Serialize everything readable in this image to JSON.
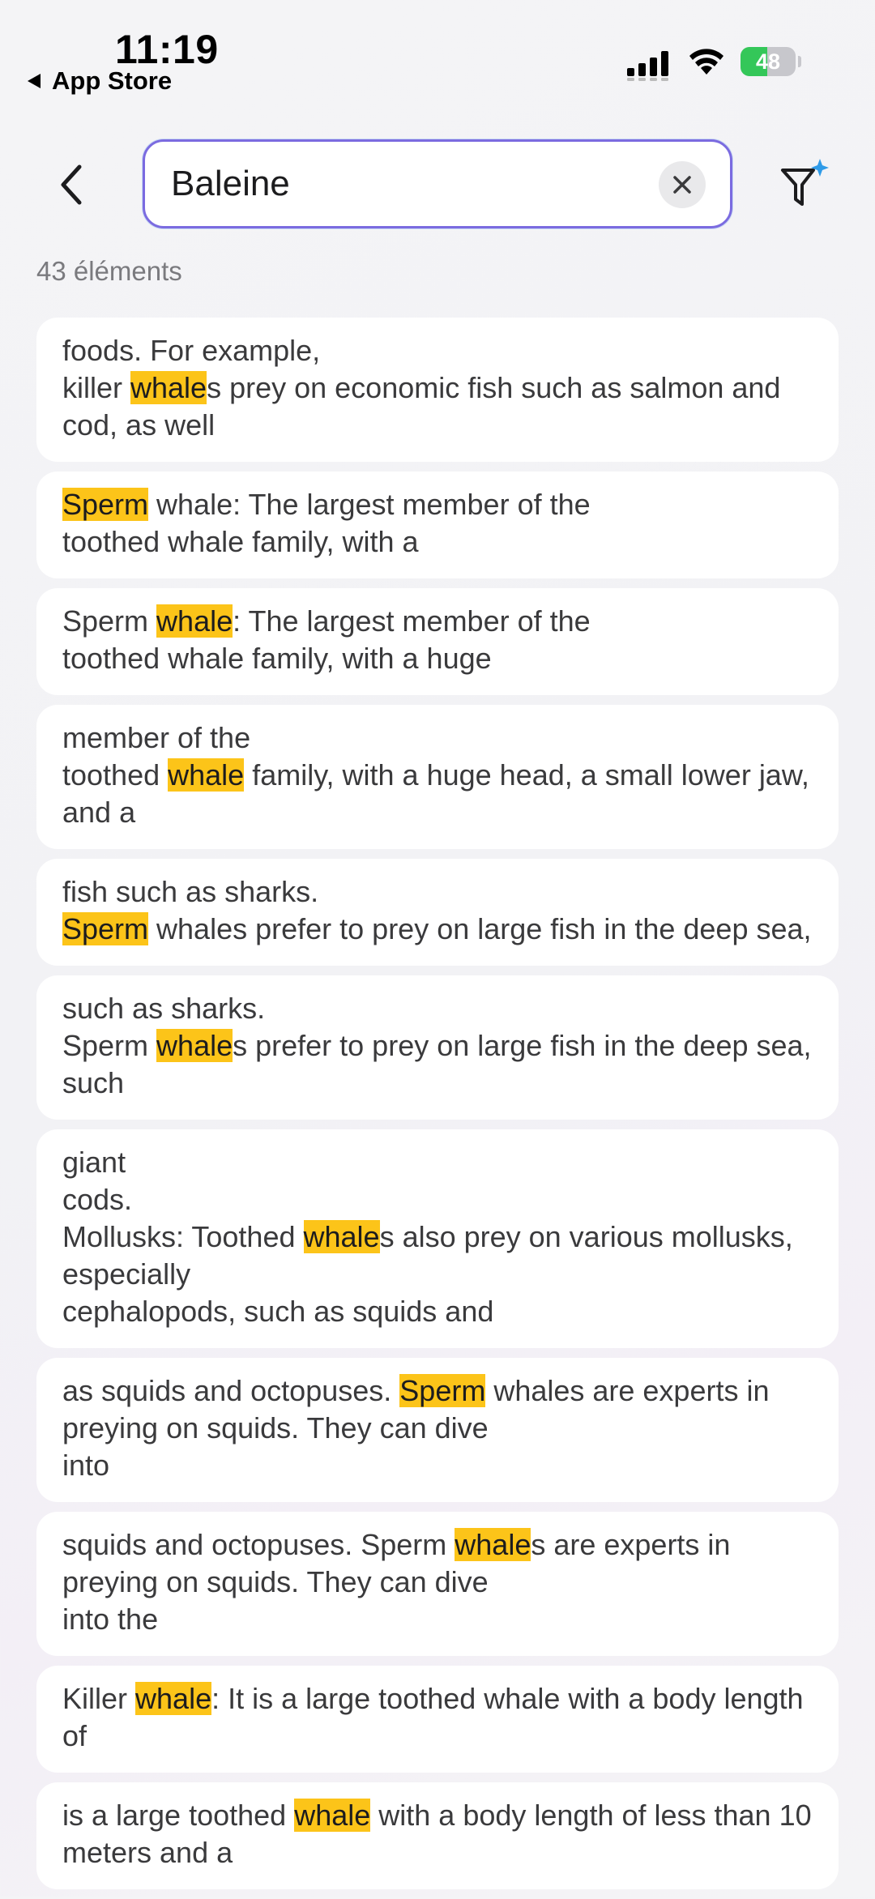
{
  "status_bar": {
    "time": "11:19",
    "back_app": "App Store",
    "battery_percent": 48,
    "battery_label": "48"
  },
  "search": {
    "query": "Baleine",
    "placeholder": ""
  },
  "results": {
    "count_label": "43 éléments",
    "highlight_color": "#fcc419",
    "items": [
      [
        {
          "t": "foods. For example,\nkiller "
        },
        {
          "h": "whale"
        },
        {
          "t": "s prey on economic fish such as salmon and cod, as well"
        }
      ],
      [
        {
          "h": "Sperm"
        },
        {
          "t": " whale: The largest member of the\ntoothed whale family, with a"
        }
      ],
      [
        {
          "t": "Sperm "
        },
        {
          "h": "whale"
        },
        {
          "t": ": The largest member of the\ntoothed whale family, with a huge"
        }
      ],
      [
        {
          "t": "member of the\ntoothed "
        },
        {
          "h": "whale"
        },
        {
          "t": " family, with a huge head, a small lower jaw, and a"
        }
      ],
      [
        {
          "t": "fish such as sharks.\n"
        },
        {
          "h": "Sperm"
        },
        {
          "t": " whales prefer to prey on large fish in the deep sea,"
        }
      ],
      [
        {
          "t": "such as sharks.\nSperm "
        },
        {
          "h": "whale"
        },
        {
          "t": "s prefer to prey on large fish in the deep sea, such"
        }
      ],
      [
        {
          "t": "giant\ncods.\nMollusks: Toothed "
        },
        {
          "h": "whale"
        },
        {
          "t": "s also prey on various mollusks, especially\ncephalopods, such as squids and"
        }
      ],
      [
        {
          "t": "as squids and octopuses. "
        },
        {
          "h": "Sperm"
        },
        {
          "t": " whales are experts in preying on squids. They can dive\ninto"
        }
      ],
      [
        {
          "t": "squids and octopuses. Sperm "
        },
        {
          "h": "whale"
        },
        {
          "t": "s are experts in preying on squids. They can dive\ninto the"
        }
      ],
      [
        {
          "t": "Killer "
        },
        {
          "h": "whale"
        },
        {
          "t": ": It is a large toothed whale with a body length of"
        }
      ],
      [
        {
          "t": "is a large toothed "
        },
        {
          "h": "whale"
        },
        {
          "t": " with a body length of less than 10 meters and a"
        }
      ]
    ]
  },
  "icons": {
    "back": "chevron-left-icon",
    "clear": "close-icon",
    "filter": "sparkle-filter-icon"
  }
}
